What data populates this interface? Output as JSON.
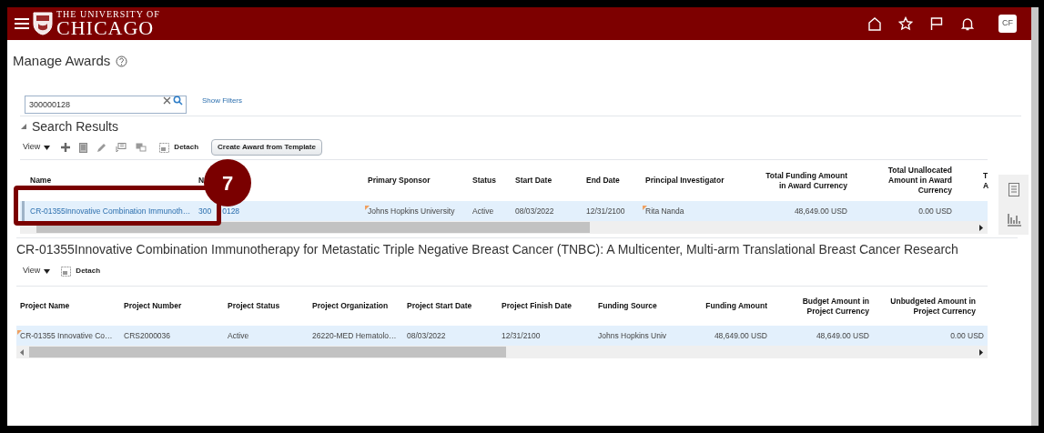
{
  "header": {
    "logo_top": "THE UNIVERSITY OF",
    "logo_main": "CHICAGO",
    "avatar": "CF"
  },
  "page_title": "Manage Awards",
  "search": {
    "value": "300000128",
    "show_filters": "Show Filters"
  },
  "results": {
    "title": "Search Results",
    "expanded": true,
    "toolbar": {
      "view": "View",
      "detach": "Detach",
      "create_button": "Create Award from Template"
    },
    "columns": [
      {
        "lines": [
          "Name"
        ]
      },
      {
        "lines": [
          "N"
        ]
      },
      {
        "lines": [
          "Primary Sponsor"
        ]
      },
      {
        "lines": [
          "Status"
        ]
      },
      {
        "lines": [
          "Start Date"
        ]
      },
      {
        "lines": [
          "End Date"
        ]
      },
      {
        "lines": [
          "Principal Investigator"
        ]
      },
      {
        "lines": [
          "Total Funding Amount",
          "in Award Currency"
        ]
      },
      {
        "lines": [
          "Total Unallocated",
          "Amount in Award",
          "Currency"
        ]
      },
      {
        "lines": [
          "T",
          "A"
        ]
      }
    ],
    "rows": [
      {
        "selected": true,
        "cells": [
          {
            "text": "CR-01355Innovative Combination Immunoth…",
            "kind": "link"
          },
          {
            "parts": [
              "300",
              "0128"
            ],
            "kind": "split_link"
          },
          {
            "text": "Johns Hopkins University",
            "kind": "flagged"
          },
          {
            "text": "Active",
            "kind": "plain"
          },
          {
            "text": "08/03/2022",
            "kind": "plain"
          },
          {
            "text": "12/31/2100",
            "kind": "plain"
          },
          {
            "text": "Rita Nanda",
            "kind": "flagged"
          },
          {
            "text": "48,649.00 USD",
            "kind": "plain"
          },
          {
            "text": "0.00 USD",
            "kind": "plain"
          }
        ]
      }
    ]
  },
  "detail": {
    "title": "CR-01355Innovative Combination Immunotherapy for Metastatic Triple Negative Breast Cancer (TNBC): A Multicenter, Multi-arm Translational Breast Cancer Research",
    "toolbar": {
      "view": "View",
      "detach": "Detach"
    },
    "columns": [
      {
        "lines": [
          "Project Name"
        ]
      },
      {
        "lines": [
          "Project Number"
        ]
      },
      {
        "lines": [
          "Project Status"
        ]
      },
      {
        "lines": [
          "Project Organization"
        ]
      },
      {
        "lines": [
          "Project Start Date"
        ]
      },
      {
        "lines": [
          "Project Finish Date"
        ]
      },
      {
        "lines": [
          "Funding Source"
        ]
      },
      {
        "lines": [
          "Funding Amount"
        ]
      },
      {
        "lines": [
          "Budget Amount in",
          "Project Currency"
        ]
      },
      {
        "lines": [
          "Unbudgeted Amount in",
          "Project Currency"
        ]
      }
    ],
    "rows": [
      {
        "selected": true,
        "cells": [
          {
            "text": "CR-01355 Innovative Co…",
            "kind": "flagged"
          },
          {
            "text": "CRS2000036",
            "kind": "plain"
          },
          {
            "text": "Active",
            "kind": "plain"
          },
          {
            "text": "26220-MED Hematolo…",
            "kind": "plain"
          },
          {
            "text": "08/03/2022",
            "kind": "plain"
          },
          {
            "text": "12/31/2100",
            "kind": "plain"
          },
          {
            "text": "Johns Hopkins Univ",
            "kind": "plain"
          },
          {
            "text": "48,649.00 USD",
            "kind": "plain"
          },
          {
            "text": "48,649.00 USD",
            "kind": "plain"
          },
          {
            "text": "0.00 USD",
            "kind": "plain"
          }
        ]
      }
    ]
  },
  "annotation": {
    "number": "7"
  }
}
